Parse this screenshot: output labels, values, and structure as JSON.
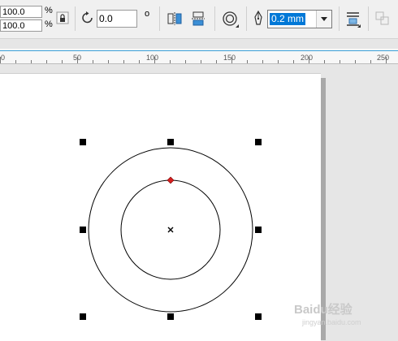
{
  "toolbar": {
    "scale_x": "100.0",
    "scale_y": "100.0",
    "percent_symbol": "%",
    "rotation_angle": "0.0",
    "degree_symbol": "o",
    "outline_width": "0.2 mm"
  },
  "ruler": {
    "ticks": [
      "0",
      "50",
      "100",
      "150",
      "200",
      "250"
    ]
  },
  "watermark": {
    "text": "Baidu经验",
    "sub": "jingyan.baidu.com"
  }
}
